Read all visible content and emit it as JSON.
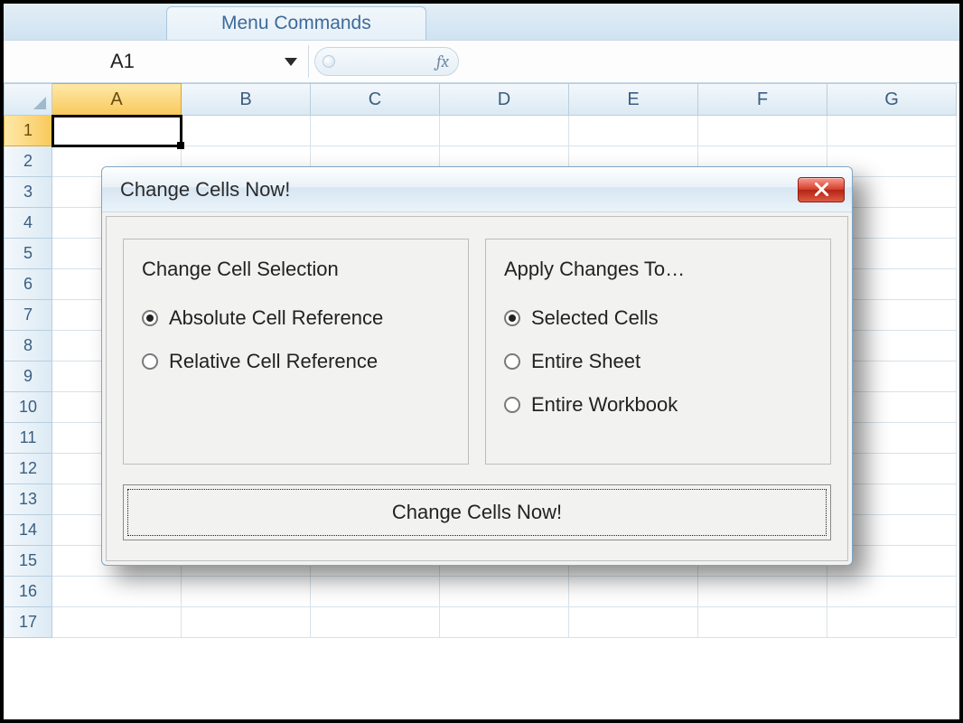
{
  "ribbon": {
    "active_tab": "Menu Commands"
  },
  "name_box": {
    "value": "A1"
  },
  "formula_bar": {
    "fx_label": "fx"
  },
  "columns": [
    "A",
    "B",
    "C",
    "D",
    "E",
    "F",
    "G"
  ],
  "rows": [
    "1",
    "2",
    "3",
    "4",
    "5",
    "6",
    "7",
    "8",
    "9",
    "10",
    "11",
    "12",
    "13",
    "14",
    "15",
    "16",
    "17"
  ],
  "selected_cell": "A1",
  "dialog": {
    "title": "Change Cells Now!",
    "left_group": {
      "legend": "Change Cell Selection",
      "options": [
        {
          "label": "Absolute Cell Reference",
          "checked": true
        },
        {
          "label": "Relative Cell Reference",
          "checked": false
        }
      ]
    },
    "right_group": {
      "legend": "Apply Changes To…",
      "options": [
        {
          "label": "Selected Cells",
          "checked": true
        },
        {
          "label": "Entire Sheet",
          "checked": false
        },
        {
          "label": "Entire Workbook",
          "checked": false
        }
      ]
    },
    "action_label": "Change Cells Now!"
  }
}
